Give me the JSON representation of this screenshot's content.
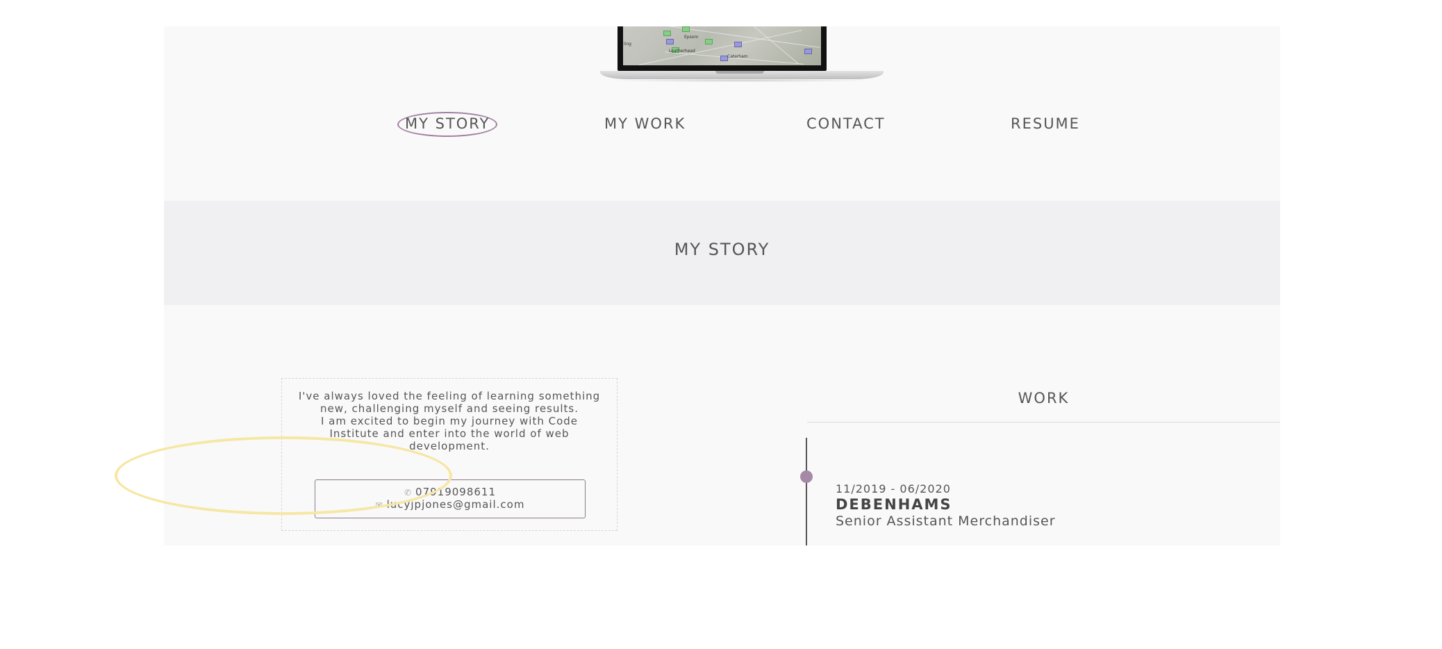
{
  "nav": {
    "items": [
      {
        "label": "MY STORY",
        "active": true
      },
      {
        "label": "MY WORK",
        "active": false
      },
      {
        "label": "CONTACT",
        "active": false
      },
      {
        "label": "RESUME",
        "active": false
      }
    ]
  },
  "section": {
    "title": "MY STORY"
  },
  "story": {
    "text": "I've always loved the feeling of learning something new, challenging myself and seeing results.\nI am excited to begin my journey with Code Institute and enter into the world of web development.",
    "phone": "07919098611",
    "email": "lucyjpjones@gmail.com",
    "phone_icon": "phone-icon",
    "email_icon": "envelope-icon"
  },
  "work": {
    "title": "WORK",
    "jobs": [
      {
        "dates": "11/2019 - 06/2020",
        "company": "DEBENHAMS",
        "role": "Senior Assistant Merchandiser"
      }
    ]
  },
  "laptop_map_labels": [
    "ling",
    "Epsom",
    "Leatherhead",
    "Caterham"
  ],
  "colors": {
    "accent": "#a07fa0",
    "highlight": "#f6e7a4",
    "band": "#f0eff1",
    "page": "#f9f9f9"
  }
}
